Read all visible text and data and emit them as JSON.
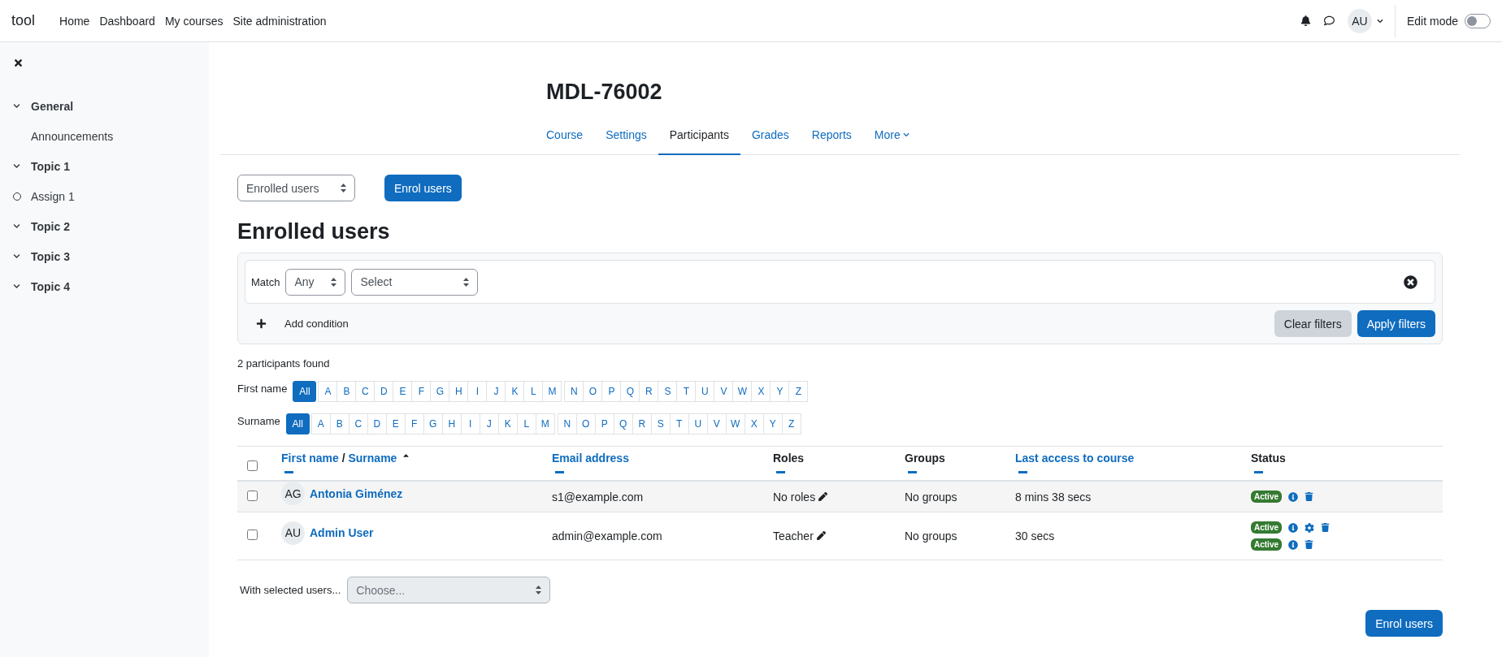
{
  "navbar": {
    "brand": "tool",
    "links": [
      {
        "label": "Home"
      },
      {
        "label": "Dashboard"
      },
      {
        "label": "My courses"
      },
      {
        "label": "Site administration"
      }
    ],
    "avatar": "AU",
    "edit_mode": {
      "label": "Edit mode",
      "on": false
    }
  },
  "sidebar": {
    "items": [
      {
        "label": "General",
        "kind": "section",
        "expanded": true
      },
      {
        "label": "Announcements",
        "kind": "activity",
        "completion": false
      },
      {
        "label": "Topic 1",
        "kind": "section",
        "expanded": true
      },
      {
        "label": "Assign 1",
        "kind": "activity",
        "completion": true
      },
      {
        "label": "Topic 2",
        "kind": "section",
        "expanded": true
      },
      {
        "label": "Topic 3",
        "kind": "section",
        "expanded": true
      },
      {
        "label": "Topic 4",
        "kind": "section",
        "expanded": true
      }
    ]
  },
  "course_title": "MDL-76002",
  "tabs": [
    {
      "label": "Course",
      "selected": false
    },
    {
      "label": "Settings",
      "selected": false
    },
    {
      "label": "Participants",
      "selected": true
    },
    {
      "label": "Grades",
      "selected": false
    },
    {
      "label": "Reports",
      "selected": false
    },
    {
      "label": "More",
      "selected": false,
      "dropdown": true
    }
  ],
  "view_select": "Enrolled users",
  "enrol_button": "Enrol users",
  "heading": "Enrolled users",
  "filter": {
    "match_label": "Match",
    "match_value": "Any",
    "type_value": "Select",
    "add_condition": "Add condition",
    "clear": "Clear filters",
    "apply": "Apply filters"
  },
  "found": "2 participants found",
  "initials_bars": [
    {
      "label": "First name",
      "all": {
        "label": "All",
        "selected": true
      },
      "letters": [
        "A",
        "B",
        "C",
        "D",
        "E",
        "F",
        "G",
        "H",
        "I",
        "J",
        "K",
        "L",
        "M",
        "N",
        "O",
        "P",
        "Q",
        "R",
        "S",
        "T",
        "U",
        "V",
        "W",
        "X",
        "Y",
        "Z"
      ]
    },
    {
      "label": "Surname",
      "all": {
        "label": "All",
        "selected": true
      },
      "letters": [
        "A",
        "B",
        "C",
        "D",
        "E",
        "F",
        "G",
        "H",
        "I",
        "J",
        "K",
        "L",
        "M",
        "N",
        "O",
        "P",
        "Q",
        "R",
        "S",
        "T",
        "U",
        "V",
        "W",
        "X",
        "Y",
        "Z"
      ]
    }
  ],
  "table": {
    "select_all_checked": false,
    "columns": [
      {
        "label": "First name",
        "separator": "/",
        "label2": "Surname",
        "sortable": true,
        "sorted": true
      },
      {
        "label": "Email address",
        "sortable": true
      },
      {
        "label": "Roles",
        "sortable": false
      },
      {
        "label": "Groups",
        "sortable": false
      },
      {
        "label": "Last access to course",
        "sortable": true
      },
      {
        "label": "Status",
        "sortable": false
      }
    ],
    "rows": [
      {
        "checked": false,
        "initials": "AG",
        "name": "Antonia Giménez",
        "email": "s1@example.com",
        "roles": "No roles",
        "groups": "No groups",
        "last_access": "8 mins 38 secs",
        "enrolments": [
          {
            "status": "Active",
            "actions": [
              {
                "kind": "info"
              },
              {
                "kind": "delete"
              }
            ]
          }
        ]
      },
      {
        "checked": false,
        "initials": "AU",
        "name": "Admin User",
        "email": "admin@example.com",
        "roles": "Teacher",
        "groups": "No groups",
        "last_access": "30 secs",
        "enrolments": [
          {
            "status": "Active",
            "actions": [
              {
                "kind": "info"
              },
              {
                "kind": "settings"
              },
              {
                "kind": "delete"
              }
            ]
          },
          {
            "status": "Active",
            "actions": [
              {
                "kind": "info"
              },
              {
                "kind": "delete"
              }
            ]
          }
        ]
      }
    ]
  },
  "bulk": {
    "label": "With selected users...",
    "placeholder": "Choose...",
    "disabled": true
  },
  "bottom_button": "Enrol users"
}
